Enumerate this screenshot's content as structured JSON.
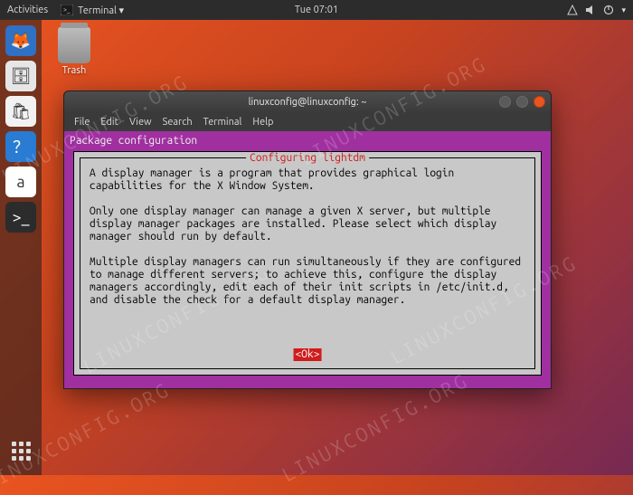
{
  "panel": {
    "activities": "Activities",
    "app_indicator": "Terminal ▾",
    "clock": "Tue 07:01"
  },
  "desktop": {
    "trash_label": "Trash"
  },
  "window": {
    "title": "linuxconfig@linuxconfig: ~",
    "menubar": [
      "File",
      "Edit",
      "View",
      "Search",
      "Terminal",
      "Help"
    ]
  },
  "ncurses": {
    "header": "Package configuration",
    "dialog_title": "Configuring lightdm",
    "body": "A display manager is a program that provides graphical login\ncapabilities for the X Window System.\n\nOnly one display manager can manage a given X server, but multiple\ndisplay manager packages are installed. Please select which display\nmanager should run by default.\n\nMultiple display managers can run simultaneously if they are configured\nto manage different servers; to achieve this, configure the display\nmanagers accordingly, edit each of their init scripts in /etc/init.d,\nand disable the check for a default display manager.",
    "ok": "<Ok>"
  },
  "dock_items": [
    {
      "name": "firefox",
      "bg": "#2f71c4",
      "glyph": "🦊"
    },
    {
      "name": "files",
      "bg": "#e6e6e6",
      "glyph": "🗄"
    },
    {
      "name": "software",
      "bg": "#f2f2f2",
      "glyph": "🛍"
    },
    {
      "name": "help",
      "bg": "#2a7bd2",
      "glyph": "？"
    },
    {
      "name": "amazon",
      "bg": "#ffffff",
      "glyph": "a"
    },
    {
      "name": "terminal",
      "bg": "#2c2c2c",
      "glyph": ">_"
    }
  ],
  "watermark": "LINUXCONFIG.ORG"
}
